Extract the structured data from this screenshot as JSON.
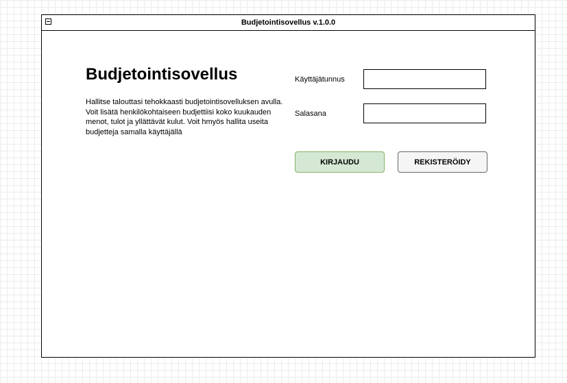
{
  "window": {
    "title": "Budjetointisovellus v.1.0.0"
  },
  "intro": {
    "heading": "Budjetointisovellus",
    "description": "Hallitse talouttasi tehokkaasti budjetointisovelluksen avulla. Voit lisätä henkilökohtaiseen budjettiisi koko kuukauden menot, tulot ja yllättävät kulut. Voit hmyös hallita useita budjetteja samalla käyttäjällä"
  },
  "login_form": {
    "username_label": "Käyttäjätunnus",
    "username_value": "",
    "password_label": "Salasana",
    "password_value": "",
    "login_button": "KIRJAUDU",
    "register_button": "REKISTERÖIDY"
  },
  "colors": {
    "login_button_fill": "#d5e8d4",
    "login_button_border": "#82b366",
    "register_button_fill": "#f5f5f5",
    "register_button_border": "#666666"
  }
}
